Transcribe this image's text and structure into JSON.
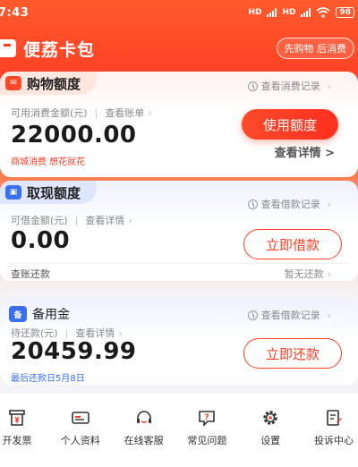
{
  "status_bar": {
    "time": "7:43",
    "network_1": "HD",
    "network_2": "HD",
    "battery": "98"
  },
  "header": {
    "app_name": "便荔卡包",
    "slogan": "先购物 后消费"
  },
  "shopping": {
    "title": "购物额度",
    "record_link": "查看消费记录",
    "label": "可用消费金额(元)",
    "bill_link": "查看账单",
    "amount": "22000.00",
    "subtext": "商城消费 想花就花",
    "button": "使用额度",
    "details_link": "查看详情 >"
  },
  "cash": {
    "title": "取现额度",
    "record_link": "查看借款记录",
    "label": "可借金额(元)",
    "details_link": "查看详情",
    "amount": "0.00",
    "button": "立即借款",
    "footer_left": "查账还款",
    "footer_right": "暂无还款"
  },
  "reserve": {
    "title": "备用金",
    "record_link": "查看借款记录",
    "label": "待还款(元)",
    "details_link": "查看详情",
    "amount": "20459.99",
    "due": "最后还款日5月8日",
    "button": "立即还款"
  },
  "bottom_nav": [
    {
      "label": "开发票",
      "icon": "invoice-icon"
    },
    {
      "label": "个人资料",
      "icon": "id-card-icon"
    },
    {
      "label": "在线客服",
      "icon": "headset-icon"
    },
    {
      "label": "常见问题",
      "icon": "faq-icon"
    },
    {
      "label": "设置",
      "icon": "gear-icon"
    },
    {
      "label": "投诉中心",
      "icon": "complaint-icon"
    }
  ],
  "colors": {
    "accent": "#ff3d24",
    "blue": "#3a6ff0",
    "text_gray": "#888888"
  }
}
